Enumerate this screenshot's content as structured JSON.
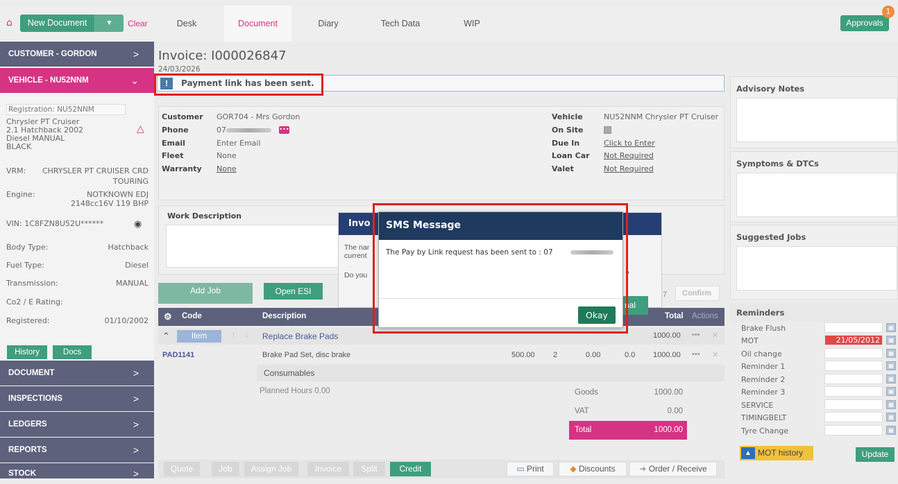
{
  "nav": {
    "new_document": "New Document",
    "clear": "Clear",
    "tabs": [
      "Desk",
      "Document",
      "Diary",
      "Tech Data",
      "WIP"
    ],
    "approvals": "Approvals",
    "approvals_count": "1"
  },
  "sidebar": {
    "customer_header": "CUSTOMER - GORDON",
    "vehicle_header": "VEHICLE - NU52NNM",
    "registration": "Registration: NU52NNM",
    "model_line1": "Chrysler PT Cruiser",
    "model_line2": "2.1 Hatchback 2002",
    "model_line3": "Diesel MANUAL",
    "model_line4": "BLACK",
    "vrm_label": "VRM:",
    "vrm_value1": "CHRYSLER PT CRUISER CRD",
    "vrm_value2": "TOURING",
    "engine_label": "Engine:",
    "engine_value1": "NOTKNOWN EDJ",
    "engine_value2": "2148cc16V  119 BHP",
    "vin": "VIN: 1C8FZN8U52U******",
    "body_type_label": "Body Type:",
    "body_type_value": "Hatchback",
    "fuel_label": "Fuel Type:",
    "fuel_value": "Diesel",
    "trans_label": "Transmission:",
    "trans_value": "MANUAL",
    "co2_label": "Co2 / E Rating:",
    "registered_label": "Registered:",
    "registered_value": "01/10/2002",
    "history": "History",
    "docs": "Docs",
    "sections": [
      "DOCUMENT",
      "INSPECTIONS",
      "LEDGERS",
      "REPORTS",
      "STOCK"
    ]
  },
  "invoice": {
    "title": "Invoice: I000026847",
    "date": "24/03/2026",
    "alert": "Payment link has been sent."
  },
  "customer": {
    "customer_label": "Customer",
    "customer_value": "GOR704 - Mrs Gordon",
    "phone_label": "Phone",
    "phone_prefix": "07",
    "email_label": "Email",
    "email_value": "Enter Email",
    "fleet_label": "Fleet",
    "fleet_value": "None",
    "warranty_label": "Warranty",
    "warranty_value": "None",
    "vehicle_label": "Vehicle",
    "vehicle_value": "NU52NNM Chrysler PT Cruiser",
    "onsite_label": "On Site",
    "duein_label": "Due In",
    "duein_value": "Click to Enter",
    "loancar_label": "Loan Car",
    "loancar_value": "Not Required",
    "valet_label": "Valet",
    "valet_value": "Not Required"
  },
  "work": {
    "title": "Work Description"
  },
  "jobs": {
    "add_job": "Add Job",
    "open_esi": "Open ESI",
    "confirm": "Confirm",
    "col_code": "Code",
    "col_description": "Description",
    "col_total": "Total",
    "col_actions": "Actions",
    "item": "Item",
    "job_title": "Replace Brake Pads",
    "job_total": "1000.00",
    "part_code": "PAD1141",
    "part_desc": "Brake Pad Set, disc brake",
    "part_price": "500.00",
    "part_qty": "2",
    "part_disc": "0.00",
    "part_vat": "0.0",
    "part_total": "1000.00",
    "consumables": "Consumables",
    "planned_hours": "Planned Hours 0.00",
    "goods_label": "Goods",
    "goods_value": "1000.00",
    "vat_label": "VAT",
    "vat_value": "0.00",
    "total_label": "Total",
    "total_value": "1000.00"
  },
  "bottom": {
    "quote": "Quote",
    "job": "Job",
    "assign_job": "Assign Job",
    "invoice": "Invoice",
    "split": "Split",
    "credit": "Credit",
    "print": "Print",
    "discounts": "Discounts",
    "order_receive": "Order / Receive"
  },
  "right": {
    "advisory": "Advisory Notes",
    "symptoms": "Symptoms & DTCs",
    "suggested": "Suggested Jobs",
    "reminders": "Reminders",
    "reminder_items": [
      "Brake Flush",
      "MOT",
      "Oil change",
      "Reminder 1",
      "Reminder 2",
      "Reminder 3",
      "SERVICE",
      "TIMINGBELT",
      "Tyre Change"
    ],
    "mot_date": "21/05/2012",
    "mot_history": "MOT history",
    "update": "Update"
  },
  "background_dialog": {
    "title": "Invo",
    "line1": "The nar",
    "line2": "current",
    "line3": "Do you",
    "q": "?",
    "seven": "7",
    "nal": "nal"
  },
  "modal": {
    "title": "SMS Message",
    "body": "The Pay by Link request has been sent to : 07",
    "okay": "Okay"
  }
}
